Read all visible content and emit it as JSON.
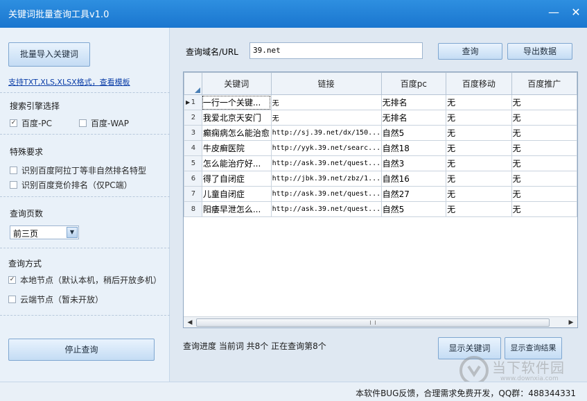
{
  "window": {
    "title": "关键词批量查询工具v1.0",
    "minimize_glyph": "—",
    "close_glyph": "✕"
  },
  "left": {
    "import_button": "批量导入关键词",
    "template_link": "支持TXT,XLS,XLSX格式，查看模板",
    "engine_section": "搜索引擎选择",
    "engines": [
      {
        "label": "百度-PC",
        "checked": true
      },
      {
        "label": "百度-WAP",
        "checked": false
      }
    ],
    "special_section": "特殊要求",
    "special": [
      {
        "label": "识别百度阿拉丁等非自然排名特型",
        "checked": false
      },
      {
        "label": "识别百度竞价排名（仅PC端）",
        "checked": false
      }
    ],
    "pages_section": "查询页数",
    "pages_selected": "前三页",
    "mode_section": "查询方式",
    "modes": [
      {
        "label": "本地节点（默认本机，稍后开放多机）",
        "checked": true
      },
      {
        "label": "云端节点（暂未开放）",
        "checked": false
      }
    ],
    "stop_button": "停止查询"
  },
  "right": {
    "domain_label": "查询域名/URL",
    "domain_value": "39.net",
    "query_button": "查询",
    "export_button": "导出数据",
    "columns": [
      "关键词",
      "链接",
      "百度pc",
      "百度移动",
      "百度推广"
    ],
    "rows": [
      {
        "num": "1",
        "keyword": "一行一个关键...",
        "link": "无",
        "pc": "无排名",
        "mobile": "无",
        "promo": "无"
      },
      {
        "num": "2",
        "keyword": "我爱北京天安门",
        "link": "无",
        "pc": "无排名",
        "mobile": "无",
        "promo": "无"
      },
      {
        "num": "3",
        "keyword": "癫痫病怎么能治愈",
        "link": "http://sj.39.net/dx/150...",
        "pc": "自然5",
        "mobile": "无",
        "promo": "无"
      },
      {
        "num": "4",
        "keyword": "牛皮癣医院",
        "link": "http://yyk.39.net/searc...",
        "pc": "自然18",
        "mobile": "无",
        "promo": "无"
      },
      {
        "num": "5",
        "keyword": "怎么能治疗好...",
        "link": "http://ask.39.net/quest...",
        "pc": "自然3",
        "mobile": "无",
        "promo": "无"
      },
      {
        "num": "6",
        "keyword": "得了自闭症",
        "link": "http://jbk.39.net/zbz/1...",
        "pc": "自然16",
        "mobile": "无",
        "promo": "无"
      },
      {
        "num": "7",
        "keyword": "儿童自闭症",
        "link": "http://ask.39.net/quest...",
        "pc": "自然27",
        "mobile": "无",
        "promo": "无"
      },
      {
        "num": "8",
        "keyword": "阳痿早泄怎么...",
        "link": "http://ask.39.net/quest...",
        "pc": "自然5",
        "mobile": "无",
        "promo": "无"
      }
    ],
    "progress": "查询进度  当前词  共8个  正在查询第8个",
    "show_keywords_button": "显示关键词",
    "show_results_button": "显示查询结果"
  },
  "status": {
    "text": "本软件BUG反馈，合理需求免费开发，QQ群：488344331"
  },
  "watermark": {
    "main": "当下软件园",
    "sub": "www.downxia.com"
  }
}
